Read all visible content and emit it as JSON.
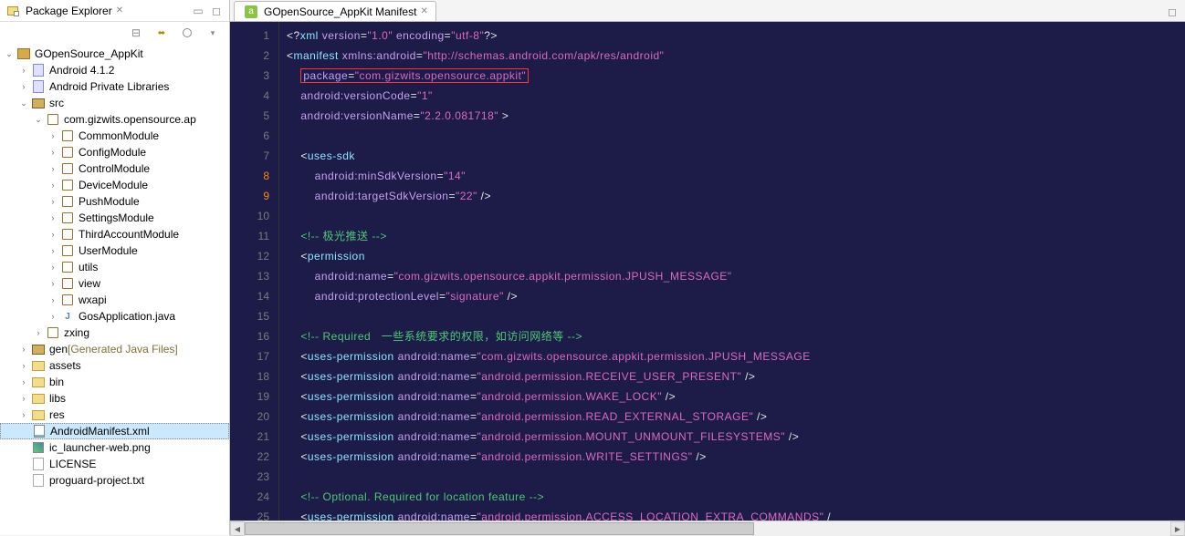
{
  "leftPanel": {
    "title": "Package Explorer",
    "tree": [
      {
        "depth": 0,
        "twist": "v",
        "icon": "project",
        "label": "GOpenSource_AppKit",
        "sel": false
      },
      {
        "depth": 1,
        "twist": ">",
        "icon": "jar",
        "label": "Android 4.1.2",
        "sel": false
      },
      {
        "depth": 1,
        "twist": ">",
        "icon": "jar",
        "label": "Android Private Libraries",
        "sel": false
      },
      {
        "depth": 1,
        "twist": "v",
        "icon": "srcfolder",
        "label": "src",
        "sel": false
      },
      {
        "depth": 2,
        "twist": "v",
        "icon": "package",
        "label": "com.gizwits.opensource.ap",
        "sel": false
      },
      {
        "depth": 3,
        "twist": ">",
        "icon": "package",
        "label": "CommonModule",
        "sel": false
      },
      {
        "depth": 3,
        "twist": ">",
        "icon": "package",
        "label": "ConfigModule",
        "sel": false
      },
      {
        "depth": 3,
        "twist": ">",
        "icon": "package",
        "label": "ControlModule",
        "sel": false
      },
      {
        "depth": 3,
        "twist": ">",
        "icon": "package",
        "label": "DeviceModule",
        "sel": false
      },
      {
        "depth": 3,
        "twist": ">",
        "icon": "package",
        "label": "PushModule",
        "sel": false
      },
      {
        "depth": 3,
        "twist": ">",
        "icon": "package",
        "label": "SettingsModule",
        "sel": false
      },
      {
        "depth": 3,
        "twist": ">",
        "icon": "package",
        "label": "ThirdAccountModule",
        "sel": false
      },
      {
        "depth": 3,
        "twist": ">",
        "icon": "package",
        "label": "UserModule",
        "sel": false
      },
      {
        "depth": 3,
        "twist": ">",
        "icon": "package",
        "label": "utils",
        "sel": false
      },
      {
        "depth": 3,
        "twist": ">",
        "icon": "package",
        "label": "view",
        "sel": false
      },
      {
        "depth": 3,
        "twist": ">",
        "icon": "package",
        "label": "wxapi",
        "sel": false
      },
      {
        "depth": 3,
        "twist": ">",
        "icon": "java",
        "label": "GosApplication.java",
        "sel": false
      },
      {
        "depth": 2,
        "twist": ">",
        "icon": "package",
        "label": "zxing",
        "sel": false
      },
      {
        "depth": 1,
        "twist": ">",
        "icon": "srcfolder",
        "label": "gen",
        "decor": " [Generated Java Files]",
        "sel": false
      },
      {
        "depth": 1,
        "twist": ">",
        "icon": "folder",
        "label": "assets",
        "sel": false
      },
      {
        "depth": 1,
        "twist": ">",
        "icon": "folder",
        "label": "bin",
        "sel": false
      },
      {
        "depth": 1,
        "twist": ">",
        "icon": "folder",
        "label": "libs",
        "sel": false
      },
      {
        "depth": 1,
        "twist": ">",
        "icon": "folder",
        "label": "res",
        "sel": false
      },
      {
        "depth": 1,
        "twist": "",
        "icon": "xml",
        "label": "AndroidManifest.xml",
        "sel": true
      },
      {
        "depth": 1,
        "twist": "",
        "icon": "img",
        "label": "ic_launcher-web.png",
        "sel": false
      },
      {
        "depth": 1,
        "twist": "",
        "icon": "file",
        "label": "LICENSE",
        "sel": false
      },
      {
        "depth": 1,
        "twist": "",
        "icon": "file",
        "label": "proguard-project.txt",
        "sel": false
      }
    ]
  },
  "editor": {
    "tabTitle": "GOpenSource_AppKit Manifest",
    "lineStart": 1,
    "lineEnd": 25,
    "breakpointLines": [
      8,
      9
    ],
    "lines": [
      [
        {
          "c": "p",
          "t": "<?"
        },
        {
          "c": "tg",
          "t": "xml"
        },
        {
          "c": "p",
          "t": " "
        },
        {
          "c": "at",
          "t": "version"
        },
        {
          "c": "p",
          "t": "="
        },
        {
          "c": "st",
          "t": "\"1.0\""
        },
        {
          "c": "p",
          "t": " "
        },
        {
          "c": "at",
          "t": "encoding"
        },
        {
          "c": "p",
          "t": "="
        },
        {
          "c": "st",
          "t": "\"utf-8\""
        },
        {
          "c": "p",
          "t": "?>"
        }
      ],
      [
        {
          "c": "p",
          "t": "<"
        },
        {
          "c": "tg",
          "t": "manifest"
        },
        {
          "c": "p",
          "t": " "
        },
        {
          "c": "at",
          "t": "xmlns:android"
        },
        {
          "c": "p",
          "t": "="
        },
        {
          "c": "st",
          "t": "\"http://schemas.android.com/apk/res/android\""
        }
      ],
      [
        {
          "c": "p",
          "t": "    "
        },
        {
          "c": "at",
          "t": "package",
          "hl": true
        },
        {
          "c": "p",
          "t": "=",
          "hl": true
        },
        {
          "c": "st",
          "t": "\"com.gizwits.opensource.appkit\"",
          "hl": true
        }
      ],
      [
        {
          "c": "p",
          "t": "    "
        },
        {
          "c": "at",
          "t": "android:versionCode"
        },
        {
          "c": "p",
          "t": "="
        },
        {
          "c": "st",
          "t": "\"1\""
        }
      ],
      [
        {
          "c": "p",
          "t": "    "
        },
        {
          "c": "at",
          "t": "android:versionName"
        },
        {
          "c": "p",
          "t": "="
        },
        {
          "c": "st",
          "t": "\"2.2.0.081718\""
        },
        {
          "c": "p",
          "t": " >"
        }
      ],
      [],
      [
        {
          "c": "p",
          "t": "    <"
        },
        {
          "c": "tg",
          "t": "uses-sdk"
        }
      ],
      [
        {
          "c": "p",
          "t": "        "
        },
        {
          "c": "at",
          "t": "android:minSdkVersion"
        },
        {
          "c": "p",
          "t": "="
        },
        {
          "c": "st",
          "t": "\"14\""
        }
      ],
      [
        {
          "c": "p",
          "t": "        "
        },
        {
          "c": "at",
          "t": "android:targetSdkVersion"
        },
        {
          "c": "p",
          "t": "="
        },
        {
          "c": "st",
          "t": "\"22\""
        },
        {
          "c": "p",
          "t": " />"
        }
      ],
      [],
      [
        {
          "c": "p",
          "t": "    "
        },
        {
          "c": "cm",
          "t": "<!-- 极光推送 -->"
        }
      ],
      [
        {
          "c": "p",
          "t": "    <"
        },
        {
          "c": "tg",
          "t": "permission"
        }
      ],
      [
        {
          "c": "p",
          "t": "        "
        },
        {
          "c": "at",
          "t": "android:name"
        },
        {
          "c": "p",
          "t": "="
        },
        {
          "c": "st",
          "t": "\"com.gizwits.opensource.appkit.permission.JPUSH_MESSAGE\""
        }
      ],
      [
        {
          "c": "p",
          "t": "        "
        },
        {
          "c": "at",
          "t": "android:protectionLevel"
        },
        {
          "c": "p",
          "t": "="
        },
        {
          "c": "st",
          "t": "\"signature\""
        },
        {
          "c": "p",
          "t": " />"
        }
      ],
      [],
      [
        {
          "c": "p",
          "t": "    "
        },
        {
          "c": "cm",
          "t": "<!-- Required   一些系统要求的权限，如访问网络等 -->"
        }
      ],
      [
        {
          "c": "p",
          "t": "    <"
        },
        {
          "c": "tg",
          "t": "uses-permission"
        },
        {
          "c": "p",
          "t": " "
        },
        {
          "c": "at",
          "t": "android:name"
        },
        {
          "c": "p",
          "t": "="
        },
        {
          "c": "st",
          "t": "\"com.gizwits.opensource.appkit.permission.JPUSH_MESSAGE"
        }
      ],
      [
        {
          "c": "p",
          "t": "    <"
        },
        {
          "c": "tg",
          "t": "uses-permission"
        },
        {
          "c": "p",
          "t": " "
        },
        {
          "c": "at",
          "t": "android:name"
        },
        {
          "c": "p",
          "t": "="
        },
        {
          "c": "st",
          "t": "\"android.permission.RECEIVE_USER_PRESENT\""
        },
        {
          "c": "p",
          "t": " />"
        }
      ],
      [
        {
          "c": "p",
          "t": "    <"
        },
        {
          "c": "tg",
          "t": "uses-permission"
        },
        {
          "c": "p",
          "t": " "
        },
        {
          "c": "at",
          "t": "android:name"
        },
        {
          "c": "p",
          "t": "="
        },
        {
          "c": "st",
          "t": "\"android.permission.WAKE_LOCK\""
        },
        {
          "c": "p",
          "t": " />"
        }
      ],
      [
        {
          "c": "p",
          "t": "    <"
        },
        {
          "c": "tg",
          "t": "uses-permission"
        },
        {
          "c": "p",
          "t": " "
        },
        {
          "c": "at",
          "t": "android:name"
        },
        {
          "c": "p",
          "t": "="
        },
        {
          "c": "st",
          "t": "\"android.permission.READ_EXTERNAL_STORAGE\""
        },
        {
          "c": "p",
          "t": " />"
        }
      ],
      [
        {
          "c": "p",
          "t": "    <"
        },
        {
          "c": "tg",
          "t": "uses-permission"
        },
        {
          "c": "p",
          "t": " "
        },
        {
          "c": "at",
          "t": "android:name"
        },
        {
          "c": "p",
          "t": "="
        },
        {
          "c": "st",
          "t": "\"android.permission.MOUNT_UNMOUNT_FILESYSTEMS\""
        },
        {
          "c": "p",
          "t": " />"
        }
      ],
      [
        {
          "c": "p",
          "t": "    <"
        },
        {
          "c": "tg",
          "t": "uses-permission"
        },
        {
          "c": "p",
          "t": " "
        },
        {
          "c": "at",
          "t": "android:name"
        },
        {
          "c": "p",
          "t": "="
        },
        {
          "c": "st",
          "t": "\"android.permission.WRITE_SETTINGS\""
        },
        {
          "c": "p",
          "t": " />"
        }
      ],
      [],
      [
        {
          "c": "p",
          "t": "    "
        },
        {
          "c": "cm",
          "t": "<!-- Optional. Required for location feature -->"
        }
      ],
      [
        {
          "c": "p",
          "t": "    <"
        },
        {
          "c": "tg",
          "t": "uses-permission"
        },
        {
          "c": "p",
          "t": " "
        },
        {
          "c": "at",
          "t": "android:name"
        },
        {
          "c": "p",
          "t": "="
        },
        {
          "c": "st",
          "t": "\"android.permission.ACCESS_LOCATION_EXTRA_COMMANDS\""
        },
        {
          "c": "p",
          "t": " /"
        }
      ]
    ]
  }
}
